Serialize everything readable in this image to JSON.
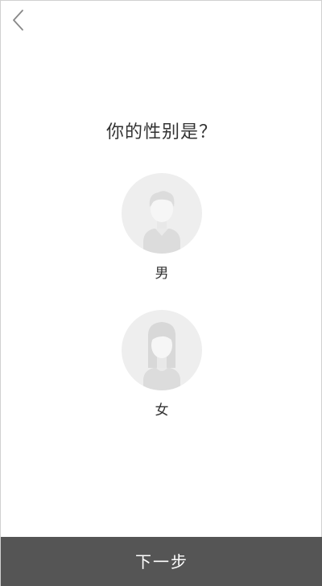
{
  "header": {
    "back_icon": "chevron-left-icon"
  },
  "question": {
    "title": "你的性别是？"
  },
  "options": [
    {
      "label": "男",
      "icon": "male-avatar-icon"
    },
    {
      "label": "女",
      "icon": "female-avatar-icon"
    }
  ],
  "footer": {
    "next_label": "下一步"
  },
  "colors": {
    "background": "#ffffff",
    "avatar_bg": "#eeeeee",
    "avatar_figure": "#dddddd",
    "footer_bg": "#555555",
    "text": "#333333"
  }
}
